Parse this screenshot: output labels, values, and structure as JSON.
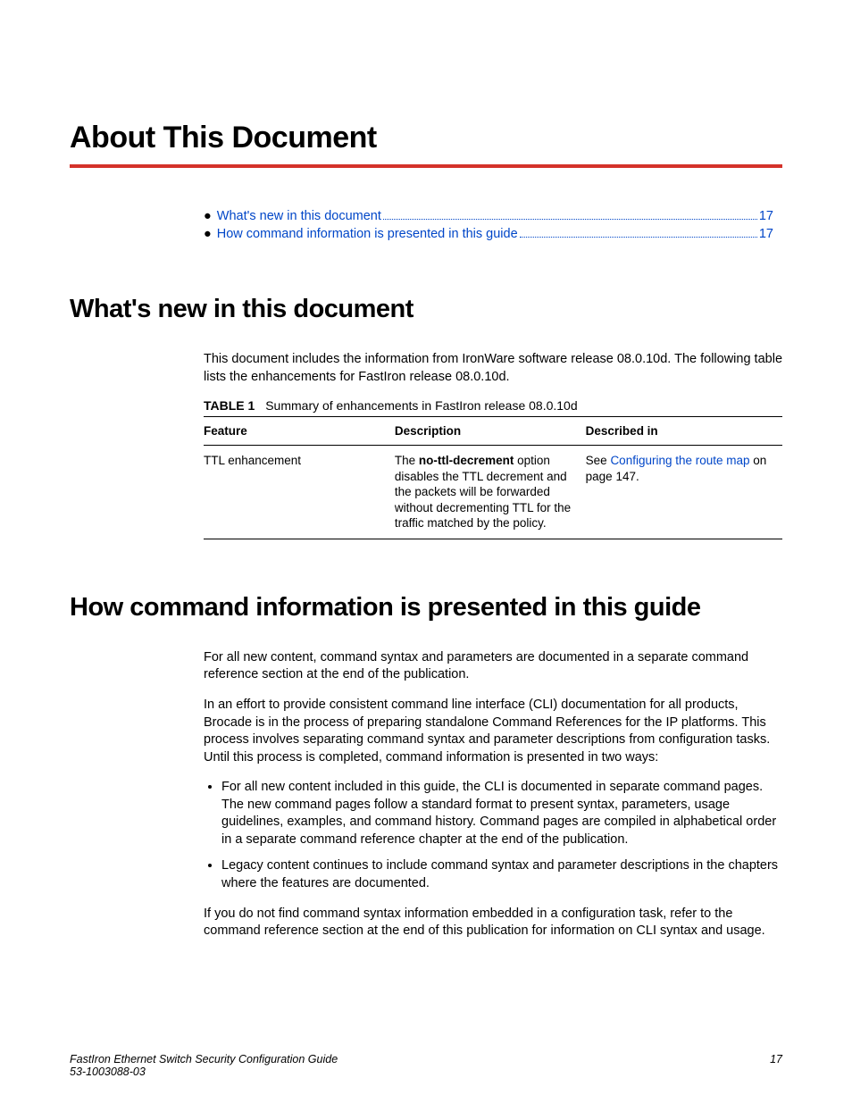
{
  "chapter_title": "About This Document",
  "toc": [
    {
      "text": "What's new in this document",
      "page": "17"
    },
    {
      "text": "How command information is presented in this guide",
      "page": "17"
    }
  ],
  "section1": {
    "title": "What's new in this document",
    "intro": "This document includes the information from IronWare software release 08.0.10d. The following table lists the enhancements for FastIron release 08.0.10d.",
    "table_label": "TABLE 1",
    "table_caption": "Summary of enhancements in FastIron release 08.0.10d",
    "table_headers": [
      "Feature",
      "Description",
      "Described in"
    ],
    "table_row": {
      "feature": "TTL enhancement",
      "desc_pre": "The ",
      "desc_bold": "no-ttl-decrement",
      "desc_post": " option disables the TTL decrement and the packets will be forwarded without decrementing TTL for the traffic matched by the policy.",
      "ref_pre": "See ",
      "ref_link": "Configuring the route map",
      "ref_post": " on page 147."
    }
  },
  "section2": {
    "title": "How command information is presented in this guide",
    "p1": "For all new content, command syntax and parameters are documented in a separate command reference section at the end of the publication.",
    "p2": "In an effort to provide consistent command line interface (CLI) documentation for all products, Brocade is in the process of preparing standalone Command References for the IP platforms. This process involves separating command syntax and parameter descriptions from configuration tasks. Until this process is completed, command information is presented in two ways:",
    "bullets": [
      "For all new content included in this guide, the CLI is documented in separate command pages. The new command pages follow a standard format to present syntax, parameters, usage guidelines, examples, and command history. Command pages are compiled in alphabetical order in a separate command reference chapter at the end of the publication.",
      "Legacy content continues to include command syntax and parameter descriptions in the chapters where the features are documented."
    ],
    "p3": "If you do not find command syntax information embedded in a configuration task, refer to the command reference section at the end of this publication for information on CLI syntax and usage."
  },
  "footer": {
    "title": "FastIron Ethernet Switch Security Configuration Guide",
    "docnum": "53-1003088-03",
    "page": "17"
  }
}
